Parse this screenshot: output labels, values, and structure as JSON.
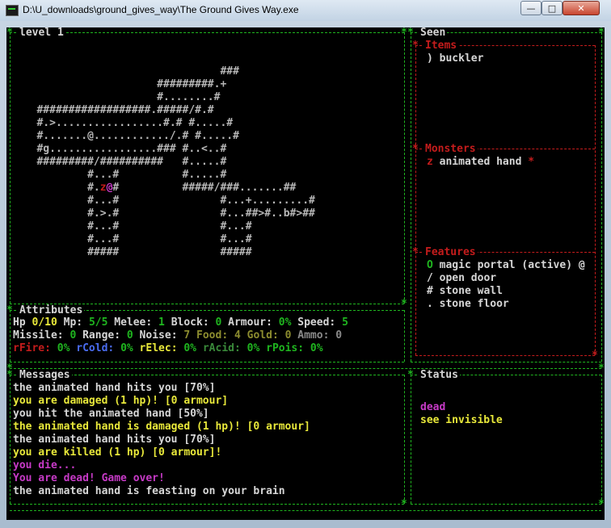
{
  "window": {
    "title": "D:\\U_downloads\\ground_gives_way\\The Ground Gives Way.exe",
    "min": "—",
    "max": "□",
    "close": "✕"
  },
  "map": {
    "title": "level 1",
    "rows": [
      {
        "parts": [
          {
            "t": "                                ###",
            "c": "mp"
          }
        ]
      },
      {
        "parts": [
          {
            "t": "                      #########.+",
            "c": "mp"
          }
        ]
      },
      {
        "parts": [
          {
            "t": "                      #........#",
            "c": "mp"
          }
        ]
      },
      {
        "parts": [
          {
            "t": "   ##################.#####/#.#",
            "c": "mp"
          }
        ]
      },
      {
        "parts": [
          {
            "t": "   #.>.................#.# #.....#",
            "c": "mp"
          }
        ]
      },
      {
        "parts": [
          {
            "t": "   #.......@............/.# #.....#",
            "c": "mp"
          }
        ]
      },
      {
        "parts": [
          {
            "t": "   #g.................### #..<..#",
            "c": "mp"
          }
        ]
      },
      {
        "parts": [
          {
            "t": "   #########/##########   #.....#",
            "c": "mp"
          }
        ]
      },
      {
        "parts": [
          {
            "t": "           #...#          #.....#",
            "c": "mp"
          }
        ]
      },
      {
        "parts": [
          {
            "t": "           #.",
            "c": "mp"
          },
          {
            "t": "z",
            "c": "r"
          },
          {
            "t": "@",
            "c": "m"
          },
          {
            "t": "#          #####/###.......##",
            "c": "mp"
          }
        ]
      },
      {
        "parts": [
          {
            "t": "           #...#                #...+.........#",
            "c": "mp"
          }
        ]
      },
      {
        "parts": [
          {
            "t": "           #.>.#                #...##>#..b#>##",
            "c": "mp"
          }
        ]
      },
      {
        "parts": [
          {
            "t": "           #...#                #...#",
            "c": "mp"
          }
        ]
      },
      {
        "parts": [
          {
            "t": "           #...#                #...#",
            "c": "mp"
          }
        ]
      },
      {
        "parts": [
          {
            "t": "           #####                #####",
            "c": "mp"
          }
        ]
      }
    ]
  },
  "seen": {
    "title": "Seen",
    "items_title": "Items",
    "items": [
      {
        "glyph": ")",
        "name": "buckler"
      }
    ],
    "monsters_title": "Monsters",
    "monsters": [
      {
        "glyph": "z",
        "name": "animated hand",
        "mark": "*"
      }
    ],
    "features_title": "Features",
    "features": [
      {
        "glyph": "O",
        "name": "magic portal (active) @"
      },
      {
        "glyph": "/",
        "name": "open door"
      },
      {
        "glyph": "#",
        "name": "stone wall"
      },
      {
        "glyph": ".",
        "name": "stone floor"
      }
    ]
  },
  "attributes": {
    "title": "Attributes",
    "row1": [
      {
        "label": "Hp ",
        "value": "0/10",
        "vc": "y"
      },
      {
        "label": " Mp: ",
        "value": "5/5",
        "vc": "g"
      },
      {
        "label": " Melee: ",
        "value": "1",
        "vc": "g"
      },
      {
        "label": " Block: ",
        "value": "0",
        "vc": "g"
      },
      {
        "label": " Armour: ",
        "value": "0%",
        "vc": "g"
      },
      {
        "label": " Speed: ",
        "value": "5",
        "vc": "g"
      }
    ],
    "row2": [
      {
        "label": "Missile: ",
        "value": "0",
        "vc": "g",
        "lc": "w"
      },
      {
        "label": " Range: ",
        "value": "0",
        "vc": "g",
        "lc": "w"
      },
      {
        "label": " Noise: ",
        "value": "7",
        "vc": "o",
        "lc": "w"
      },
      {
        "label": " Food: ",
        "value": "4",
        "vc": "o",
        "lc": "o"
      },
      {
        "label": " Gold: ",
        "value": "0",
        "vc": "o",
        "lc": "o"
      },
      {
        "label": " Ammo: ",
        "value": "0",
        "vc": "gr",
        "lc": "gr"
      }
    ],
    "row3": [
      {
        "label": "rFire: ",
        "value": "0%",
        "vc": "g",
        "lc": "r"
      },
      {
        "label": " rCold: ",
        "value": "0%",
        "vc": "g",
        "lc": "b"
      },
      {
        "label": " rElec: ",
        "value": "0%",
        "vc": "g",
        "lc": "y"
      },
      {
        "label": " rAcid: ",
        "value": "0%",
        "vc": "g",
        "lc": "gg"
      },
      {
        "label": " rPois: ",
        "value": "0%",
        "vc": "g",
        "lc": "g"
      }
    ]
  },
  "messages": {
    "title": "Messages",
    "lines": [
      {
        "text": "the animated hand hits you [70%]",
        "c": "w"
      },
      {
        "text": "you are damaged (1 hp)! [0 armour]",
        "c": "y"
      },
      {
        "text": "you hit the animated hand [50%]",
        "c": "w"
      },
      {
        "text": "the animated hand is damaged (1 hp)! [0 armour]",
        "c": "y"
      },
      {
        "text": "the animated hand hits you [70%]",
        "c": "w"
      },
      {
        "text": "you are killed (1 hp) [0 armour]!",
        "c": "y"
      },
      {
        "text": "you die...",
        "c": "m"
      },
      {
        "text": "You are dead! Game over!",
        "c": "m"
      },
      {
        "text": "the animated hand is feasting on your brain",
        "c": "w"
      }
    ]
  },
  "status": {
    "title": "Status",
    "lines": [
      {
        "text": "dead",
        "c": "m"
      },
      {
        "text": "see invisible",
        "c": "y"
      }
    ]
  }
}
